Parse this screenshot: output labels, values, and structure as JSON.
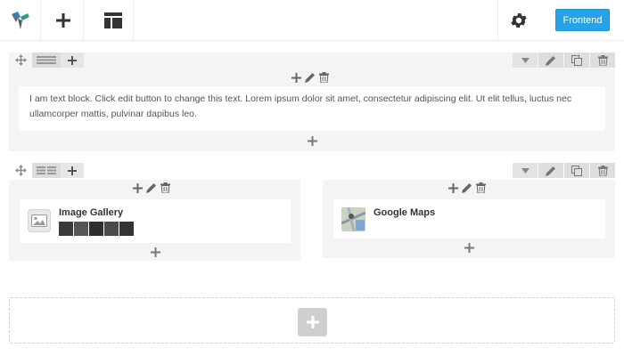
{
  "toolbar": {
    "logo_icon": "vc-logo-icon",
    "add_icon": "plus-icon",
    "templates_icon": "layout-icon",
    "settings_icon": "gear-icon",
    "frontend_label": "Frontend"
  },
  "row1": {
    "text": "I am text block. Click edit button to change this text. Lorem ipsum dolor sit amet, consectetur adipiscing elit. Ut elit tellus, luctus nec ullamcorper mattis, pulvinar dapibus leo."
  },
  "row2": {
    "col1": {
      "element_title": "Image Gallery"
    },
    "col2": {
      "element_title": "Google Maps"
    }
  },
  "colors": {
    "accent": "#27a2e6",
    "row_bg": "#f4f4f4"
  }
}
